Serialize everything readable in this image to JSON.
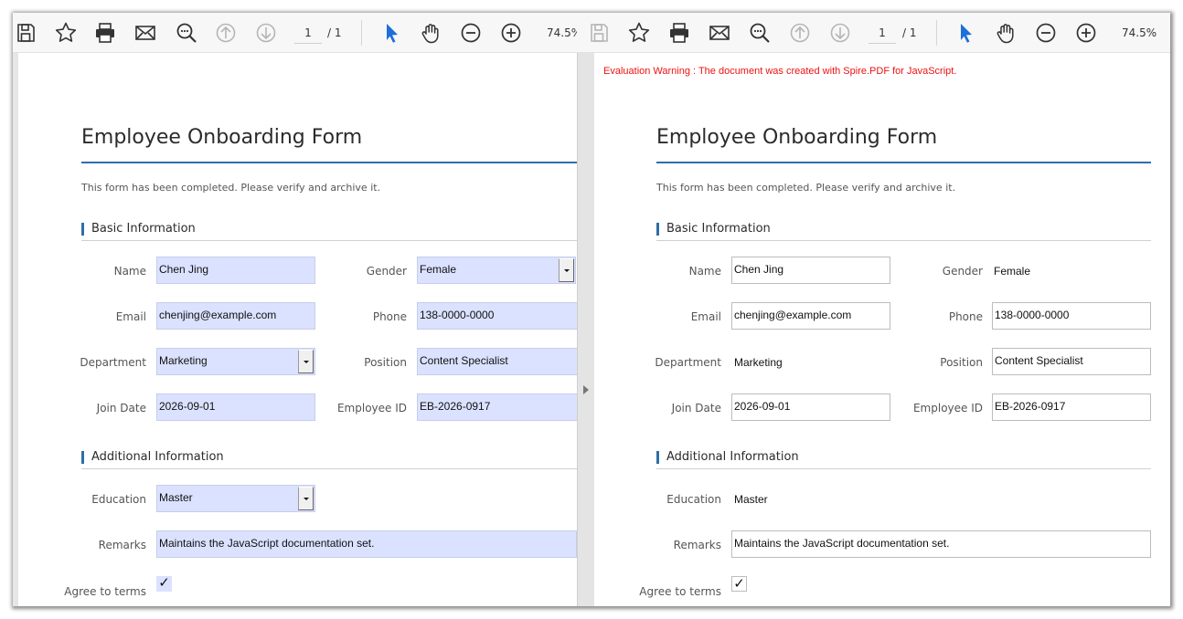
{
  "toolbar": {
    "page_current": "1",
    "page_total": "/ 1",
    "zoom": "74.5%"
  },
  "icons": [
    "save-icon",
    "star-icon",
    "print-icon",
    "mail-icon",
    "zoom-search-icon",
    "arrow-up-icon",
    "arrow-down-icon",
    "pointer-icon",
    "hand-icon",
    "zoom-out-icon",
    "zoom-in-icon"
  ],
  "colors": {
    "accent": "#2f6ea6",
    "field_fill": "#dbe2ff",
    "warning": "#ee1111",
    "pointer": "#1e6fd9"
  },
  "evaluation_warning": "Evaluation Warning : The document was created with Spire.PDF for JavaScript.",
  "form": {
    "title": "Employee Onboarding Form",
    "subtitle": "This form has been completed. Please verify and archive it.",
    "section_basic": "Basic Information",
    "section_additional": "Additional Information",
    "labels": {
      "name": "Name",
      "gender": "Gender",
      "email": "Email",
      "phone": "Phone",
      "department": "Department",
      "position": "Position",
      "join_date": "Join Date",
      "employee_id": "Employee ID",
      "education": "Education",
      "remarks": "Remarks",
      "agree": "Agree to terms"
    },
    "values": {
      "name": "Chen Jing",
      "gender": "Female",
      "email": "chenjing@example.com",
      "phone": "138-0000-0000",
      "department": "Marketing",
      "position": "Content Specialist",
      "join_date": "2026-09-01",
      "employee_id": "EB-2026-0917",
      "education": "Master",
      "remarks": "Maintains the JavaScript documentation set.",
      "agree_mark": "✓"
    }
  }
}
